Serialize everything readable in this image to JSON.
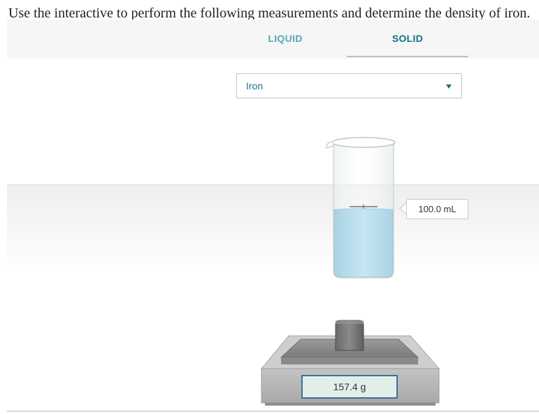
{
  "instruction": "Use the interactive to perform the following measurements and determine the density of iron.",
  "tabs": [
    {
      "label": "LIQUID",
      "selected": false
    },
    {
      "label": "SOLID",
      "selected": true
    }
  ],
  "material_select": {
    "value": "Iron"
  },
  "cylinder": {
    "volume_reading": "100.0 mL",
    "fill_fraction": 0.52
  },
  "balance": {
    "mass_reading": "157.4 g"
  },
  "colors": {
    "tab_active": "#0f7382",
    "tab_inactive": "#59a7b3",
    "water": "#bfe2ef",
    "balance_display_border": "#3d6f99"
  },
  "icons": {
    "select_arrow": "caret-down-icon"
  }
}
